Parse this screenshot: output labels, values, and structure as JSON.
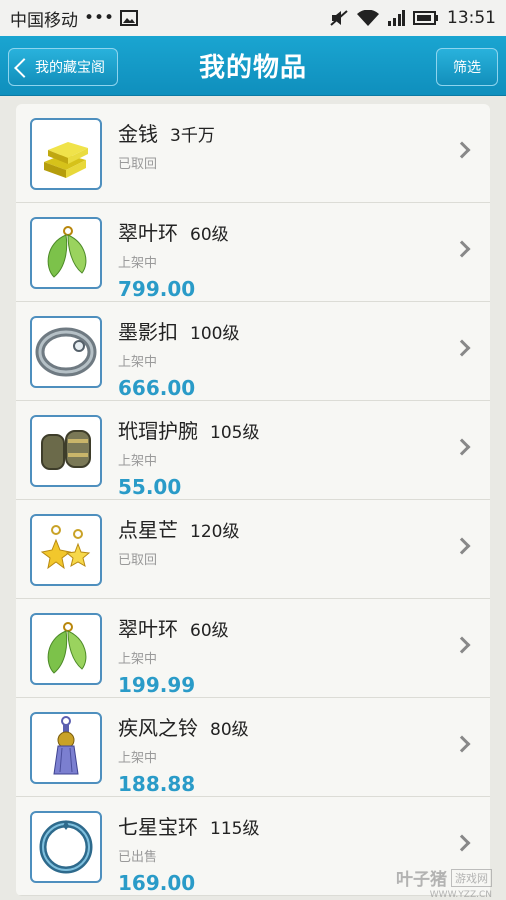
{
  "status_bar": {
    "carrier": "中国移动",
    "dots": "•••",
    "time": "13:51"
  },
  "header": {
    "back_label": "我的藏宝阁",
    "title": "我的物品",
    "filter_label": "筛选"
  },
  "items": [
    {
      "name": "金钱",
      "level": "3千万",
      "status": "已取回",
      "price": "",
      "icon": "gold-bars-icon"
    },
    {
      "name": "翠叶环",
      "level": "60级",
      "status": "上架中",
      "price": "799.00",
      "icon": "leaf-earring-icon"
    },
    {
      "name": "墨影扣",
      "level": "100级",
      "status": "上架中",
      "price": "666.00",
      "icon": "ring-icon"
    },
    {
      "name": "玳瑁护腕",
      "level": "105级",
      "status": "上架中",
      "price": "55.00",
      "icon": "bracer-icon"
    },
    {
      "name": "点星芒",
      "level": "120级",
      "status": "已取回",
      "price": "",
      "icon": "star-earring-icon"
    },
    {
      "name": "翠叶环",
      "level": "60级",
      "status": "上架中",
      "price": "199.99",
      "icon": "leaf-earring-icon"
    },
    {
      "name": "疾风之铃",
      "level": "80级",
      "status": "上架中",
      "price": "188.88",
      "icon": "bell-pendant-icon"
    },
    {
      "name": "七星宝环",
      "level": "115级",
      "status": "已出售",
      "price": "169.00",
      "icon": "star-ring-icon"
    }
  ],
  "watermark": {
    "main": "叶子猪",
    "box": "游戏网",
    "url": "WWW.YZZ.CN"
  },
  "colors": {
    "header": "#129ac6",
    "price": "#2a9bc8",
    "thumb_border": "#4e8fbe"
  }
}
